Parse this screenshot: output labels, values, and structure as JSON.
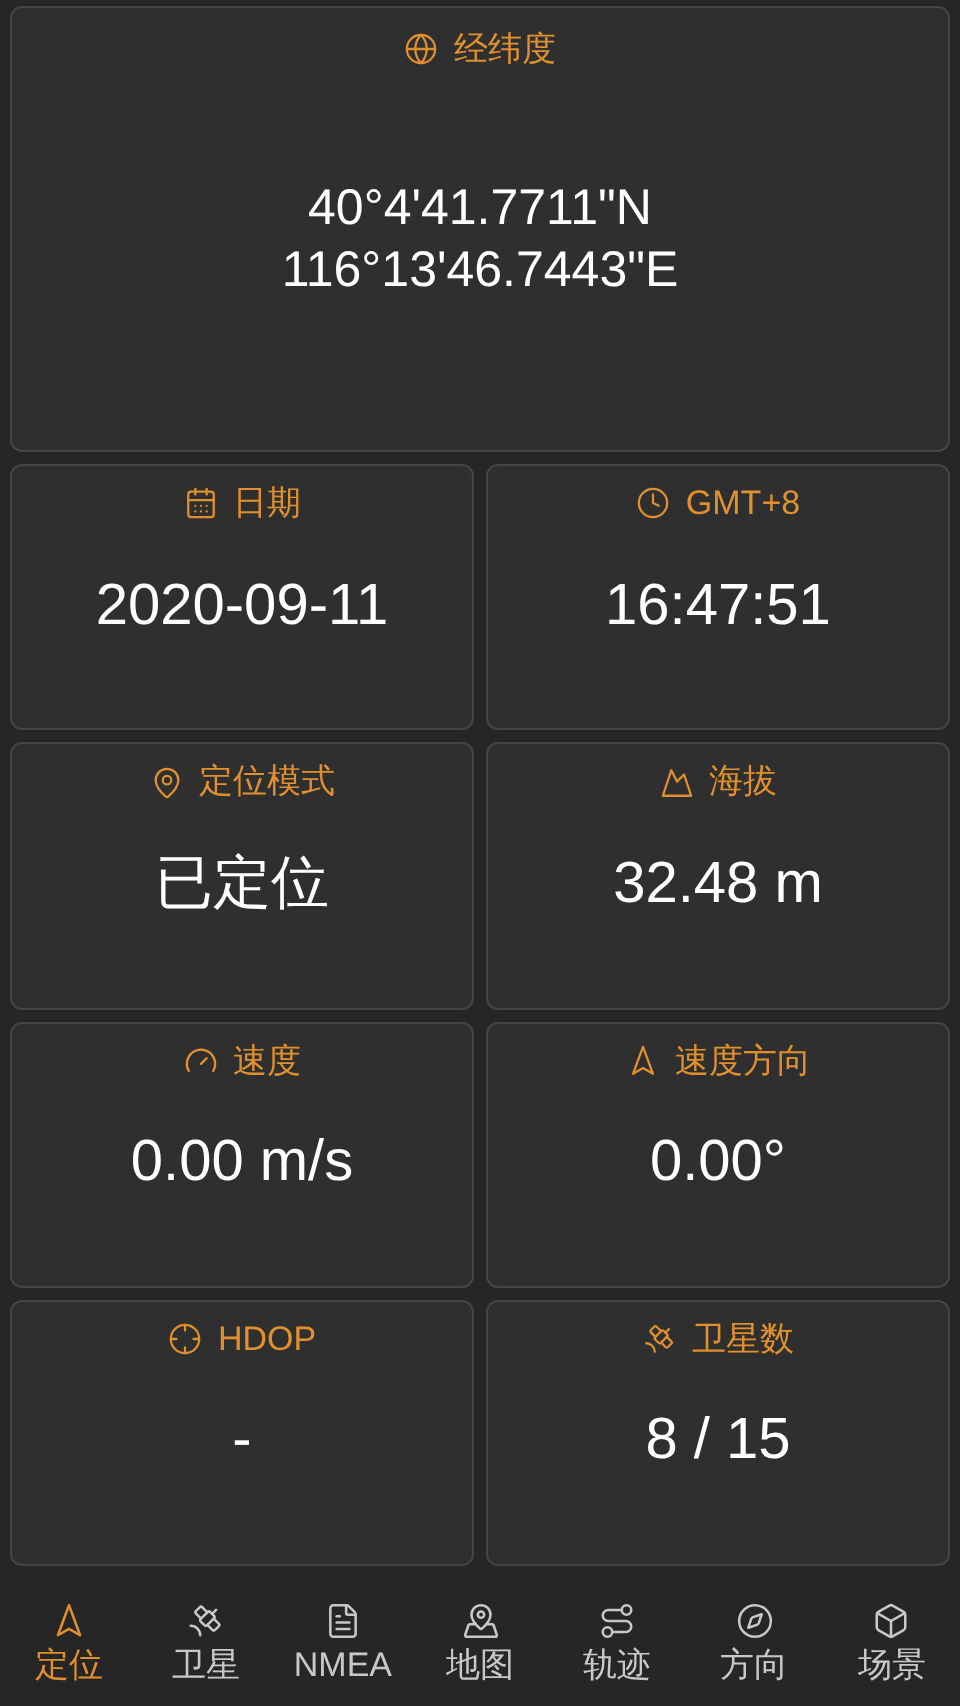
{
  "coordinates": {
    "title": "经纬度",
    "latitude": "40°4'41.7711\"N",
    "longitude": "116°13'46.7443\"E"
  },
  "cards": [
    {
      "kind": "calendar",
      "title": "日期",
      "value": "2020-09-11"
    },
    {
      "kind": "clock",
      "title": "GMT+8",
      "value": "16:47:51"
    },
    {
      "kind": "pin",
      "title": "定位模式",
      "value": "已定位"
    },
    {
      "kind": "altitude",
      "title": "海拔",
      "value": "32.48 m"
    },
    {
      "kind": "gauge",
      "title": "速度",
      "value": "0.00 m/s"
    },
    {
      "kind": "heading",
      "title": "速度方向",
      "value": "0.00°"
    },
    {
      "kind": "target",
      "title": "HDOP",
      "value": "-"
    },
    {
      "kind": "satellite",
      "title": "卫星数",
      "value": "8 / 15"
    }
  ],
  "nav": [
    {
      "kind": "heading",
      "label": "定位",
      "selected": true
    },
    {
      "kind": "satellite",
      "label": "卫星",
      "selected": false
    },
    {
      "kind": "list",
      "label": "NMEA",
      "selected": false
    },
    {
      "kind": "map",
      "label": "地图",
      "selected": false
    },
    {
      "kind": "route",
      "label": "轨迹",
      "selected": false
    },
    {
      "kind": "compass",
      "label": "方向",
      "selected": false
    },
    {
      "kind": "scene",
      "label": "场景",
      "selected": false
    }
  ]
}
